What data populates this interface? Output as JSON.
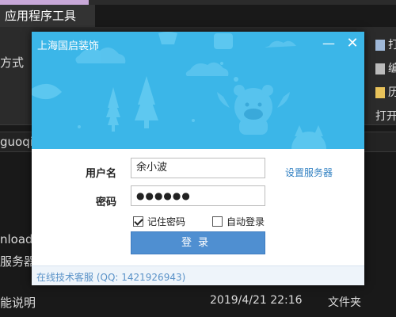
{
  "background": {
    "ribbon_tab": "应用程序工具",
    "left_text_1": "方式",
    "left_text_2": "guoqi",
    "left_text_3": "nload",
    "left_text_4": "服务器",
    "left_text_5": "能说明",
    "right_item_1": "打",
    "right_item_2": "编",
    "right_item_3": "历",
    "right_item_4": "打开",
    "row_date": "2019/4/21 22:16",
    "row_type": "文件夹"
  },
  "dialog": {
    "title": "上海国启装饰",
    "minimize_glyph": "—",
    "close_glyph": "✕",
    "username_label": "用户名",
    "username_value": "余小波",
    "password_label": "密码",
    "password_value": "●●●●●●",
    "server_link": "设置服务器",
    "remember_label": "记住密码",
    "remember_checked": true,
    "autologin_label": "自动登录",
    "autologin_checked": false,
    "login_button": "登录",
    "support_link": "在线技术客服 (QQ: 1421926943)"
  },
  "colors": {
    "banner": "#3bb6e8",
    "login_button": "#4f8fd1",
    "link": "#2f7fc1"
  }
}
